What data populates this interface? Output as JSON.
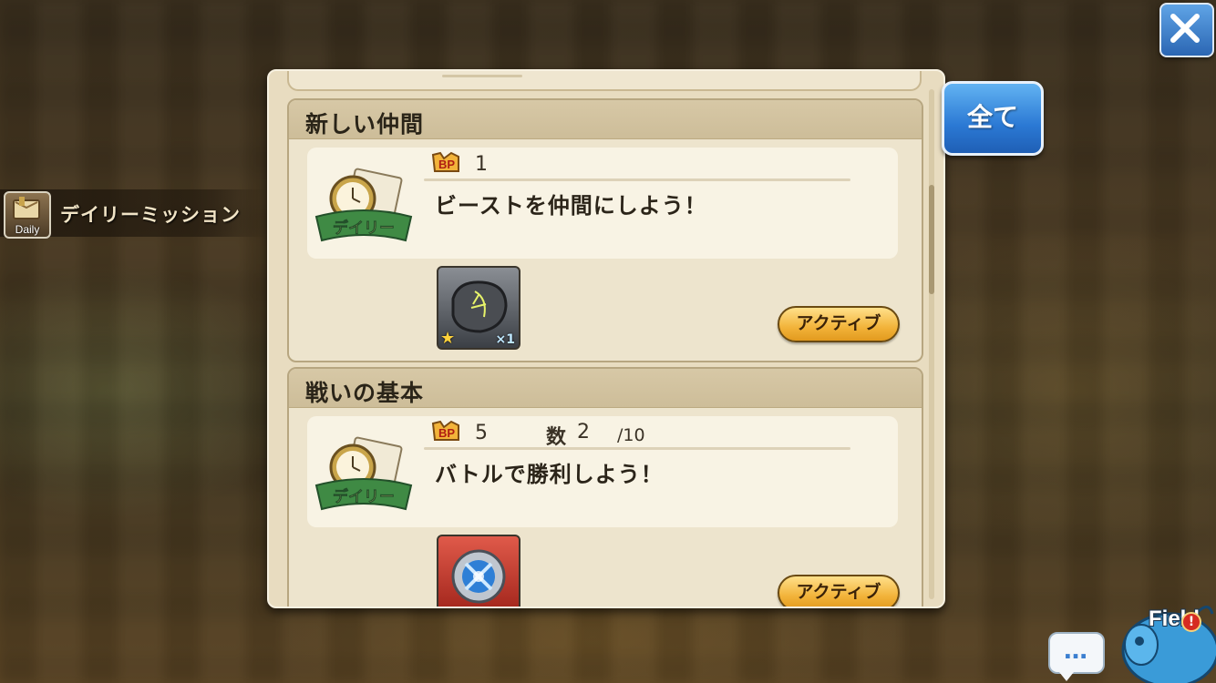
{
  "close_button": {
    "icon": "close-icon"
  },
  "sidebar": {
    "daily_icon_label": "Daily",
    "daily_title": "デイリーミッション"
  },
  "all_button": {
    "label": "全て"
  },
  "missions": [
    {
      "title": "新しい仲間",
      "badge_label": "デイリー",
      "bp": "1",
      "description": "ビーストを仲間にしよう！",
      "reward_quantity": "×1",
      "reward_icon": "beast-stone-icon",
      "button_label": "アクティブ"
    },
    {
      "title": "戦いの基本",
      "badge_label": "デイリー",
      "bp": "5",
      "count_label": "数",
      "count_value": "2",
      "count_total": "/10",
      "description": "バトルで勝利しよう！",
      "reward_icon": "crystal-orb-icon",
      "button_label": "アクティブ"
    }
  ],
  "chat_button": {
    "label": "…"
  },
  "field_button": {
    "label": "Field",
    "alert": "!"
  },
  "colors": {
    "panel_bg": "#e8dcc0",
    "active_button": "#f2b33a",
    "all_button": "#2b79d4"
  }
}
